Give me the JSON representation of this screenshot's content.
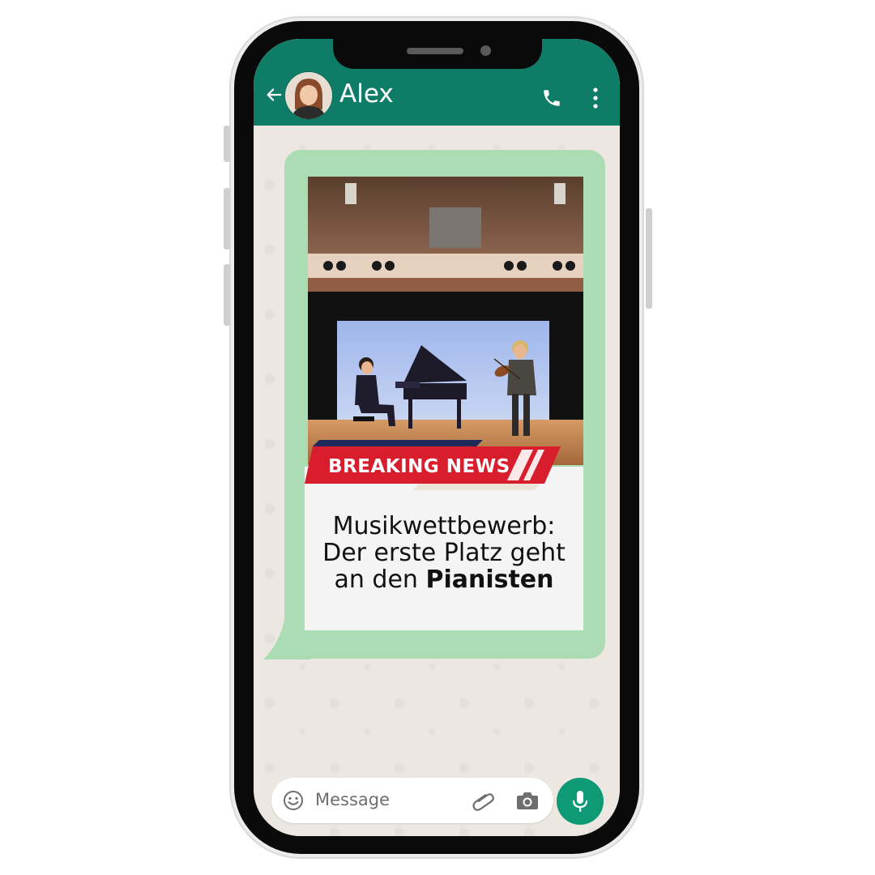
{
  "chat": {
    "contact_name": "Alex"
  },
  "message": {
    "banner": "BREAKING NEWS",
    "headline_line1": "Musikwettbewerb:",
    "headline_line2": "Der erste Platz geht",
    "headline_line3_prefix": "an den ",
    "headline_line3_bold": "Pianisten"
  },
  "composer": {
    "placeholder": "Message"
  },
  "icons": {
    "back": "arrow-left-icon",
    "call": "phone-icon",
    "menu": "kebab-menu-icon",
    "emoji": "emoji-icon",
    "attach": "paperclip-icon",
    "camera": "camera-icon",
    "mic": "microphone-icon"
  },
  "colors": {
    "header": "#0e7c66",
    "bubble": "#acdcb4",
    "banner_red": "#d81e2c",
    "banner_navy": "#1f2a5a",
    "mic_button": "#0e9a74"
  }
}
